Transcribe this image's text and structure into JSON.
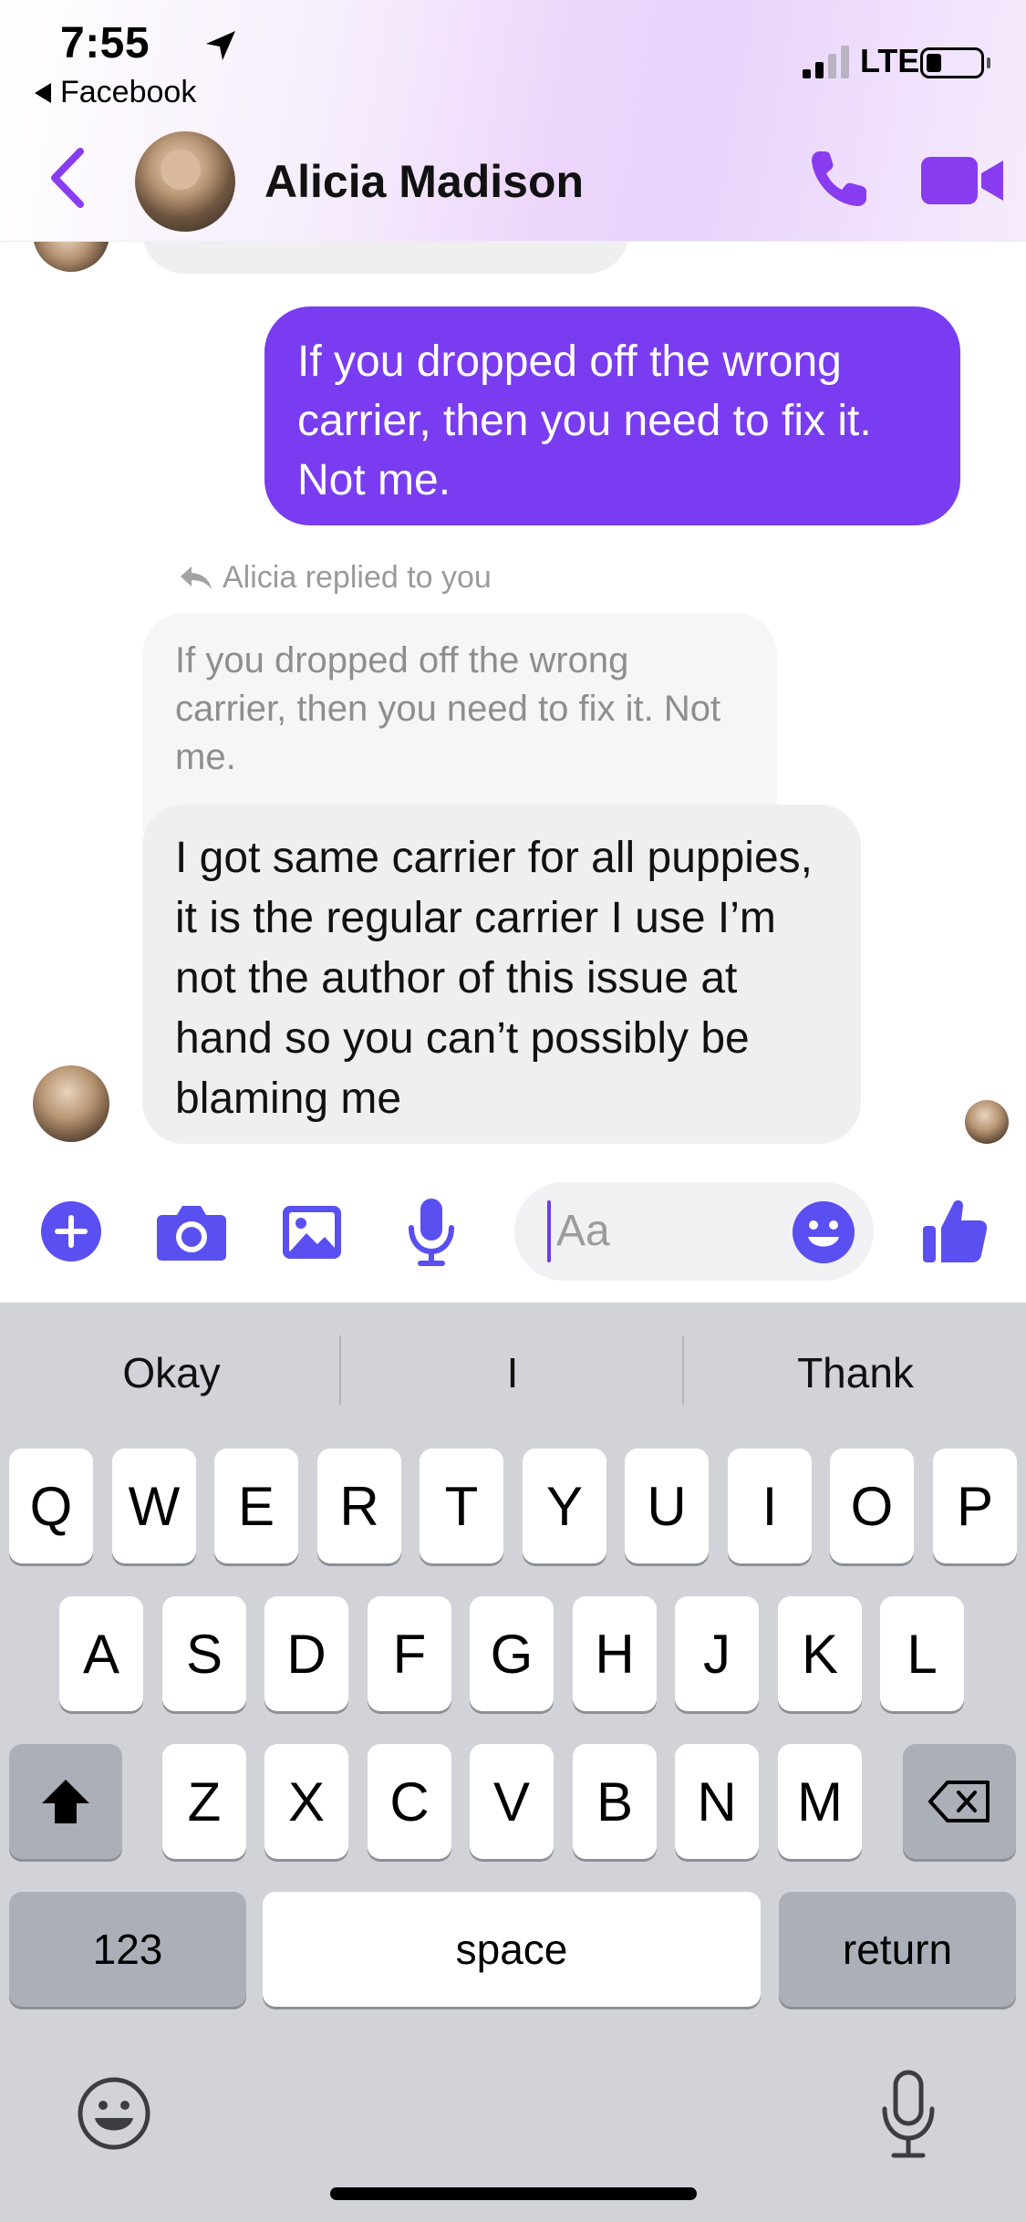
{
  "status_bar": {
    "time": "7:55",
    "back_app": "Facebook",
    "network": "LTE"
  },
  "header": {
    "contact_name": "Alicia Madison",
    "accent_color": "#8a3cf0"
  },
  "messages": {
    "sent_1": "If you dropped off the wrong carrier, then you need to fix it. Not me.",
    "reply_note": "Alicia replied to you",
    "quoted": "If you dropped off the wrong carrier, then you need to fix it. Not me.",
    "received_1": "I got same carrier for all puppies, it is the regular carrier I use I’m not the author of this issue at hand so you can’t possibly be blaming me"
  },
  "composer": {
    "placeholder": "Aa",
    "icons": [
      "plus-icon",
      "camera-icon",
      "gallery-icon",
      "microphone-icon",
      "emoji-icon",
      "thumbs-up-icon"
    ]
  },
  "keyboard": {
    "predictions": [
      "Okay",
      "I",
      "Thank"
    ],
    "row1": [
      "Q",
      "W",
      "E",
      "R",
      "T",
      "Y",
      "U",
      "I",
      "O",
      "P"
    ],
    "row2": [
      "A",
      "S",
      "D",
      "F",
      "G",
      "H",
      "J",
      "K",
      "L"
    ],
    "row3": [
      "Z",
      "X",
      "C",
      "V",
      "B",
      "N",
      "M"
    ],
    "numbers_label": "123",
    "space_label": "space",
    "return_label": "return"
  }
}
